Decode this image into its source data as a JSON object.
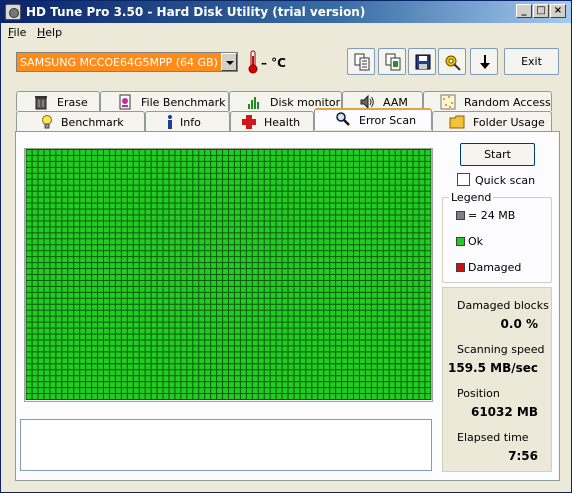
{
  "window": {
    "title": "HD Tune Pro 3.50 - Hard Disk Utility (trial version)"
  },
  "menu": [
    {
      "accel": "F",
      "rest": "ile"
    },
    {
      "accel": "H",
      "rest": "elp"
    }
  ],
  "toolbar": {
    "drive": "SAMSUNG MCCOE64G5MPP (64 GB)",
    "temperature": "– °C",
    "icons": [
      "copy-text-icon",
      "copy-screenshot-icon",
      "save-icon",
      "options-icon",
      "download-icon"
    ],
    "exit_label": "Exit"
  },
  "tabs_top": [
    {
      "label": "Erase",
      "icon": "trash-icon"
    },
    {
      "label": "File Benchmark",
      "icon": "file-benchmark-icon"
    },
    {
      "label": "Disk monitor",
      "icon": "disk-monitor-icon"
    },
    {
      "label": "AAM",
      "icon": "speaker-icon"
    },
    {
      "label": "Random Access",
      "icon": "random-access-icon"
    }
  ],
  "tabs_bottom": [
    {
      "label": "Benchmark",
      "icon": "lightbulb-icon"
    },
    {
      "label": "Info",
      "icon": "info-icon"
    },
    {
      "label": "Health",
      "icon": "health-cross-icon"
    },
    {
      "label": "Error Scan",
      "icon": "magnifier-icon",
      "active": true
    },
    {
      "label": "Folder Usage",
      "icon": "folder-icon"
    }
  ],
  "scan": {
    "start_label": "Start",
    "quick_scan_label": "Quick scan",
    "quick_scan_checked": false,
    "block_colors": {
      "ok": "#22cc22",
      "ok_border": "#0a5a0a"
    }
  },
  "legend": {
    "title": "Legend",
    "block_size": "= 24 MB",
    "ok": "Ok",
    "damaged": "Damaged",
    "colors": {
      "block": "#808080",
      "ok": "#22cc22",
      "damaged": "#cc1111"
    }
  },
  "stats": {
    "damaged_blocks_label": "Damaged blocks",
    "damaged_blocks_value": "0.0 %",
    "scanning_speed_label": "Scanning speed",
    "scanning_speed_value": "159.5 MB/sec",
    "position_label": "Position",
    "position_value": "61032 MB",
    "elapsed_label": "Elapsed time",
    "elapsed_value": "7:56"
  }
}
